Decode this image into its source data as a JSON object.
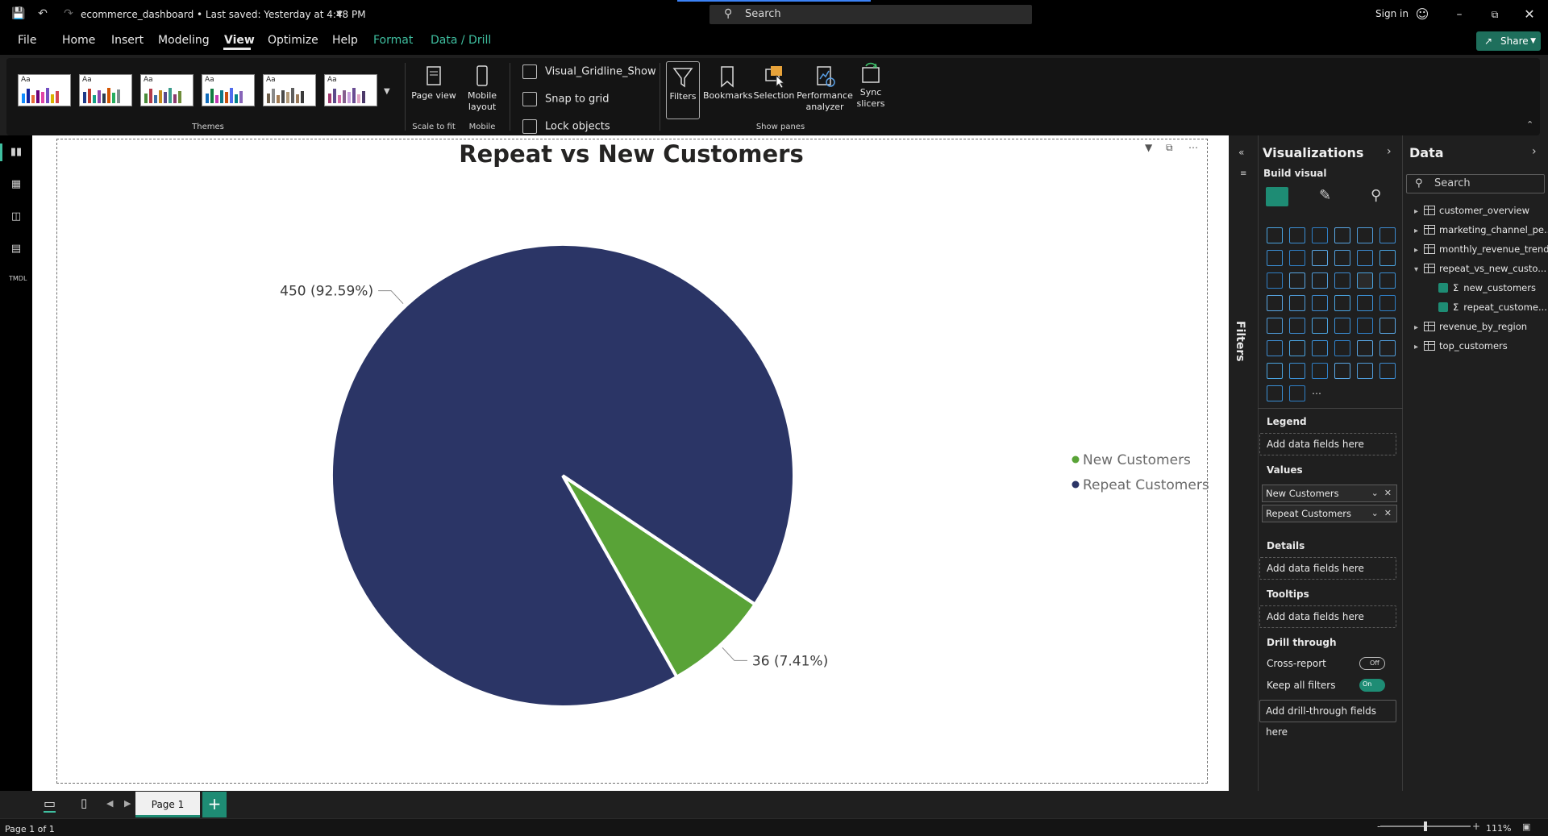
{
  "titlebar": {
    "doc_title": "ecommerce_dashboard • Last saved: Yesterday at 4:48 PM",
    "search_label": "Search",
    "signin": "Sign in"
  },
  "menu": {
    "items": [
      "File",
      "Home",
      "Insert",
      "Modeling",
      "View",
      "Optimize",
      "Help",
      "Format",
      "Data / Drill"
    ],
    "active": "View",
    "share_label": "Share"
  },
  "ribbon": {
    "themes_label": "Themes",
    "page_view_label": "Page view",
    "scale_label": "Scale to fit",
    "mobile_layout_label": "Mobile layout",
    "mobile_group_label": "Mobile",
    "checkboxes": [
      "Visual_Gridline_Show",
      "Snap to grid",
      "Lock objects"
    ],
    "panes": [
      "Filters",
      "Bookmarks",
      "Selection",
      "Performance analyzer",
      "Sync slicers"
    ],
    "show_panes_label": "Show panes"
  },
  "chart_data": {
    "type": "pie",
    "title": "Repeat vs New Customers",
    "categories": [
      "New Customers",
      "Repeat Customers"
    ],
    "values": [
      36,
      450
    ],
    "data_labels": [
      "36 (7.41%)",
      "450 (92.59%)"
    ],
    "colors": [
      "#59a337",
      "#2b3566"
    ],
    "legend_position": "right"
  },
  "filters_pane": {
    "label": "Filters"
  },
  "viz_pane": {
    "title": "Visualizations",
    "build_visual": "Build visual",
    "legend_label": "Legend",
    "legend_placeholder": "Add data fields here",
    "values_label": "Values",
    "values_fields": [
      "New Customers",
      "Repeat Customers"
    ],
    "details_label": "Details",
    "details_placeholder": "Add data fields here",
    "tooltips_label": "Tooltips",
    "tooltips_placeholder": "Add data fields here",
    "drill_label": "Drill through",
    "cross_report_label": "Cross-report",
    "cross_report_state": "Off",
    "keep_filters_label": "Keep all filters",
    "keep_filters_state": "On",
    "drill_placeholder": "Add drill-through fields here"
  },
  "data_pane": {
    "title": "Data",
    "search_placeholder": "Search",
    "tables": [
      "customer_overview",
      "marketing_channel_pe...",
      "monthly_revenue_trend",
      "repeat_vs_new_custo...",
      "revenue_by_region",
      "top_customers"
    ],
    "fields": [
      "new_customers",
      "repeat_custome..."
    ]
  },
  "pages": {
    "tab": "Page 1"
  },
  "status": {
    "page": "Page 1 of 1",
    "zoom": "111%"
  }
}
